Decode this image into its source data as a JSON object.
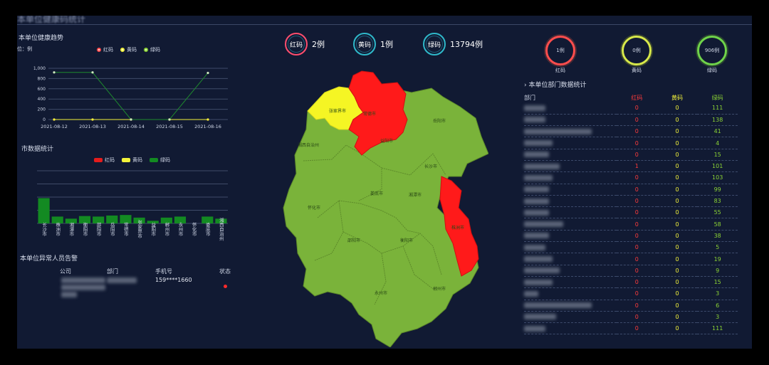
{
  "header": {
    "title": "本单位健康码统计"
  },
  "trend": {
    "title": "本单位健康趋势",
    "unit": "位：例",
    "legend": [
      {
        "label": "红码",
        "color": "#ff4d4d"
      },
      {
        "label": "黄码",
        "color": "#f2f23a"
      },
      {
        "label": "绿码",
        "color": "#8bd334"
      }
    ]
  },
  "bars": {
    "title": "市数据统计",
    "legend": [
      {
        "label": "红码",
        "color": "#e51c1c"
      },
      {
        "label": "黄码",
        "color": "#f2f23a"
      },
      {
        "label": "绿码",
        "color": "#138a22"
      }
    ]
  },
  "chart_data": [
    {
      "type": "line",
      "title": "本单位健康趋势",
      "x": [
        "2021-08-12",
        "2021-08-13",
        "2021-08-14",
        "2021-08-15",
        "2021-08-16"
      ],
      "yticks": [
        "1,000",
        "800",
        "600",
        "400",
        "200",
        "0"
      ],
      "ylim": [
        0,
        1000
      ],
      "series": [
        {
          "name": "红码",
          "color": "#ff4d4d",
          "values": [
            0,
            0,
            0,
            0,
            0
          ]
        },
        {
          "name": "黄码",
          "color": "#f2f23a",
          "values": [
            0,
            0,
            0,
            0,
            0
          ]
        },
        {
          "name": "绿码",
          "color": "#1e8a2e",
          "values": [
            920,
            920,
            0,
            0,
            910
          ]
        }
      ],
      "grid": true
    },
    {
      "type": "bar",
      "title": "市数据统计",
      "categories": [
        "长沙市",
        "株洲市",
        "湘潭市",
        "衡阳市",
        "邵阳市",
        "岳阳市",
        "常德市",
        "张家界市",
        "益阳市",
        "郴州市",
        "永州市",
        "怀化市",
        "娄底市",
        "湘西自治州"
      ],
      "ylim": [
        0,
        100
      ],
      "series": [
        {
          "name": "绿码",
          "color": "#138a22",
          "values": [
            48,
            13,
            9,
            14,
            13,
            15,
            16,
            11,
            5,
            11,
            13,
            0,
            13,
            9
          ]
        }
      ],
      "grid": true
    }
  ],
  "alarm": {
    "title": "本单位异常人员告警",
    "headers": {
      "company": "公司",
      "dept": "部门",
      "phone": "手机号",
      "status": "状态"
    },
    "rows": [
      {
        "phone": "159****1660"
      }
    ]
  },
  "stats": [
    {
      "label": "红码",
      "value": "2例",
      "color": "#ff4d6d"
    },
    {
      "label": "黄码",
      "value": "1例",
      "color": "#f2f23a"
    },
    {
      "label": "绿码",
      "value": "13794例",
      "color": "#2fb8c9"
    }
  ],
  "unit_stats": [
    {
      "value": "1例",
      "label": "红码",
      "color": "#ff4d4d"
    },
    {
      "value": "0例",
      "label": "黄码",
      "color": "#d7e84a"
    },
    {
      "value": "906例",
      "label": "绿码",
      "color": "#6fd34a"
    }
  ],
  "map": {
    "labels": [
      {
        "name": "张家界市"
      },
      {
        "name": "常德市"
      },
      {
        "name": "岳阳市"
      },
      {
        "name": "湘西自治州"
      },
      {
        "name": "益阳市"
      },
      {
        "name": "长沙市"
      },
      {
        "name": "娄底市"
      },
      {
        "name": "湘潭市"
      },
      {
        "name": "怀化市"
      },
      {
        "name": "邵阳市"
      },
      {
        "name": "衡阳市"
      },
      {
        "name": "株洲市"
      },
      {
        "name": "永州市"
      },
      {
        "name": "郴州市"
      }
    ]
  },
  "dept": {
    "title": "本单位部门数据统计",
    "headers": {
      "name": "部门",
      "red": "红码",
      "yellow": "黄码",
      "green": "绿码"
    },
    "rows": [
      {
        "red": "0",
        "yellow": "0",
        "green": "111"
      },
      {
        "red": "0",
        "yellow": "0",
        "green": "138"
      },
      {
        "red": "0",
        "yellow": "0",
        "green": "41"
      },
      {
        "red": "0",
        "yellow": "0",
        "green": "4"
      },
      {
        "red": "0",
        "yellow": "0",
        "green": "15"
      },
      {
        "red": "1",
        "yellow": "0",
        "green": "101"
      },
      {
        "red": "0",
        "yellow": "0",
        "green": "103"
      },
      {
        "red": "0",
        "yellow": "0",
        "green": "99"
      },
      {
        "red": "0",
        "yellow": "0",
        "green": "83"
      },
      {
        "red": "0",
        "yellow": "0",
        "green": "55"
      },
      {
        "red": "0",
        "yellow": "0",
        "green": "58"
      },
      {
        "red": "0",
        "yellow": "0",
        "green": "38"
      },
      {
        "red": "0",
        "yellow": "0",
        "green": "5"
      },
      {
        "red": "0",
        "yellow": "0",
        "green": "19"
      },
      {
        "red": "0",
        "yellow": "0",
        "green": "9"
      },
      {
        "red": "0",
        "yellow": "0",
        "green": "15"
      },
      {
        "red": "0",
        "yellow": "0",
        "green": "3"
      },
      {
        "red": "0",
        "yellow": "0",
        "green": "6"
      },
      {
        "red": "0",
        "yellow": "0",
        "green": "3"
      },
      {
        "red": "0",
        "yellow": "0",
        "green": "111"
      }
    ]
  }
}
